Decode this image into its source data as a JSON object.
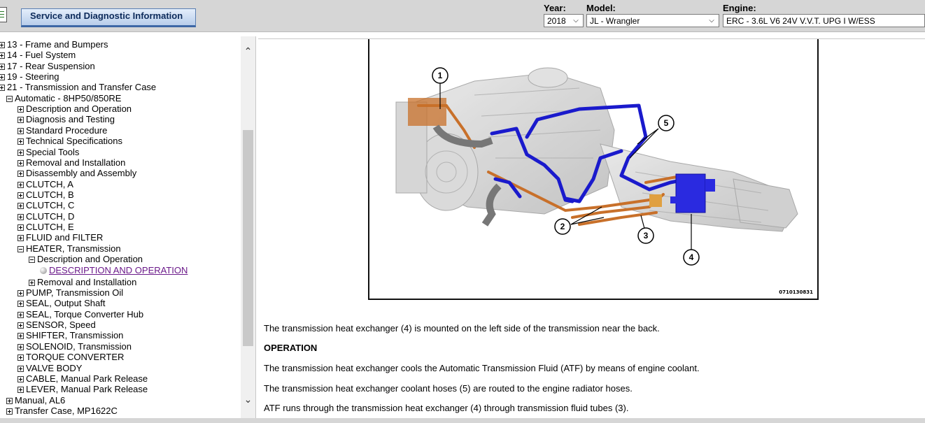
{
  "header": {
    "app_tab_label": "Service and Diagnostic Information",
    "year": {
      "label": "Year:",
      "value": "2018"
    },
    "model": {
      "label": "Model:",
      "value": "JL - Wrangler"
    },
    "engine": {
      "label": "Engine:",
      "value": "ERC - 3.6L V6 24V V.V.T. UPG I W/ESS"
    }
  },
  "tree": {
    "items": [
      {
        "label": "13 - Frame and Bumpers",
        "indent": 0,
        "state": "plus"
      },
      {
        "label": "14 - Fuel System",
        "indent": 0,
        "state": "plus"
      },
      {
        "label": "17 - Rear Suspension",
        "indent": 0,
        "state": "plus"
      },
      {
        "label": "19 - Steering",
        "indent": 0,
        "state": "plus"
      },
      {
        "label": "21 - Transmission and Transfer Case",
        "indent": 0,
        "state": "plus"
      },
      {
        "label": "Automatic - 8HP50/850RE",
        "indent": 1,
        "state": "minus"
      },
      {
        "label": "Description and Operation",
        "indent": 2,
        "state": "plus"
      },
      {
        "label": "Diagnosis and Testing",
        "indent": 2,
        "state": "plus"
      },
      {
        "label": "Standard Procedure",
        "indent": 2,
        "state": "plus"
      },
      {
        "label": "Technical Specifications",
        "indent": 2,
        "state": "plus"
      },
      {
        "label": "Special Tools",
        "indent": 2,
        "state": "plus"
      },
      {
        "label": "Removal and Installation",
        "indent": 2,
        "state": "plus"
      },
      {
        "label": "Disassembly and Assembly",
        "indent": 2,
        "state": "plus"
      },
      {
        "label": "CLUTCH, A",
        "indent": 2,
        "state": "plus"
      },
      {
        "label": "CLUTCH, B",
        "indent": 2,
        "state": "plus"
      },
      {
        "label": "CLUTCH, C",
        "indent": 2,
        "state": "plus"
      },
      {
        "label": "CLUTCH, D",
        "indent": 2,
        "state": "plus"
      },
      {
        "label": "CLUTCH, E",
        "indent": 2,
        "state": "plus"
      },
      {
        "label": "FLUID and FILTER",
        "indent": 2,
        "state": "plus"
      },
      {
        "label": "HEATER, Transmission",
        "indent": 2,
        "state": "minus"
      },
      {
        "label": "Description and Operation",
        "indent": 3,
        "state": "minus"
      },
      {
        "label": "DESCRIPTION AND OPERATION",
        "indent": 4,
        "state": "leaf"
      },
      {
        "label": "Removal and Installation",
        "indent": 3,
        "state": "plus"
      },
      {
        "label": "PUMP, Transmission Oil",
        "indent": 2,
        "state": "plus"
      },
      {
        "label": "SEAL, Output Shaft",
        "indent": 2,
        "state": "plus"
      },
      {
        "label": "SEAL, Torque Converter Hub",
        "indent": 2,
        "state": "plus"
      },
      {
        "label": "SENSOR, Speed",
        "indent": 2,
        "state": "plus"
      },
      {
        "label": "SHIFTER, Transmission",
        "indent": 2,
        "state": "plus"
      },
      {
        "label": "SOLENOID, Transmission",
        "indent": 2,
        "state": "plus"
      },
      {
        "label": "TORQUE CONVERTER",
        "indent": 2,
        "state": "plus"
      },
      {
        "label": "VALVE BODY",
        "indent": 2,
        "state": "plus"
      },
      {
        "label": "CABLE, Manual Park Release",
        "indent": 2,
        "state": "plus"
      },
      {
        "label": "LEVER, Manual Park Release",
        "indent": 2,
        "state": "plus"
      },
      {
        "label": "Manual, AL6",
        "indent": 1,
        "state": "plus"
      },
      {
        "label": "Transfer Case, MP1622C",
        "indent": 1,
        "state": "plus"
      }
    ]
  },
  "figure": {
    "id": "0710130831",
    "callouts": [
      "1",
      "2",
      "3",
      "4",
      "5"
    ],
    "colors": {
      "coolant_hoses": "#1a1acc",
      "fluid_tubes": "#c8702a",
      "heat_exchanger": "#2a2ae0"
    }
  },
  "article": {
    "intro": "The transmission heat exchanger (4) is mounted on the left side of the transmission near the back.",
    "operation_heading": "OPERATION",
    "p1": "The transmission heat exchanger cools the Automatic Transmission Fluid (ATF) by means of engine coolant.",
    "p2": "The transmission heat exchanger coolant hoses (5) are routed to the engine radiator hoses.",
    "p3": "ATF runs through the transmission heat exchanger (4) through transmission fluid tubes (3)."
  }
}
